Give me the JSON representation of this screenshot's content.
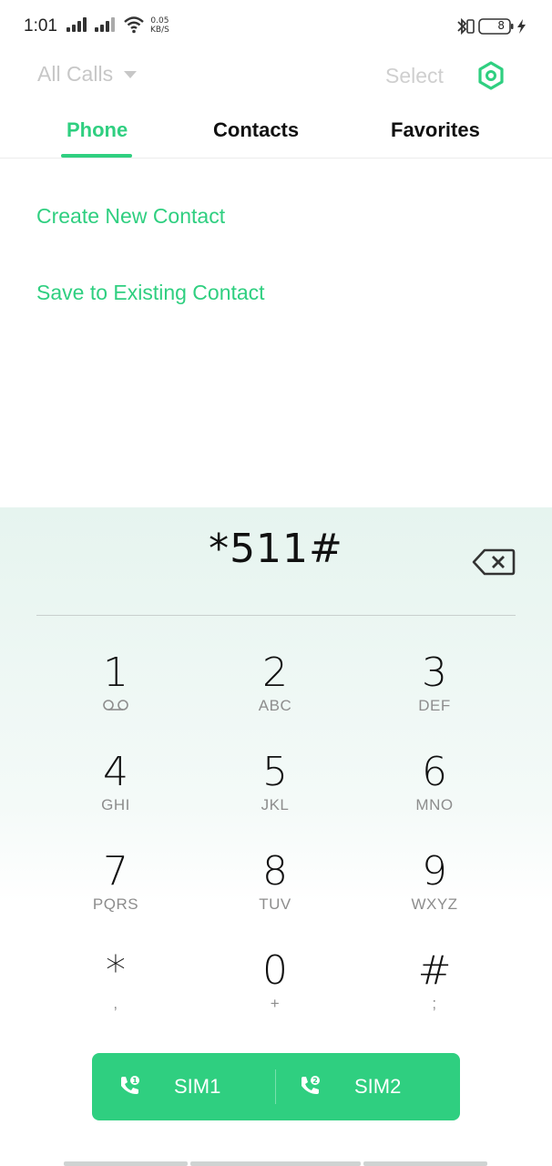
{
  "status_bar": {
    "time": "1:01",
    "net_speed_value": "0.05",
    "net_speed_unit": "KB/S",
    "battery": "8",
    "icons": [
      "signal-icon",
      "signal-icon",
      "wifi-icon",
      "bluetooth-icon",
      "vibrate-icon",
      "battery-icon",
      "charging-icon"
    ]
  },
  "header": {
    "filter_label": "All Calls",
    "select_label": "Select",
    "settings_icon": "settings-icon"
  },
  "tabs": [
    {
      "label": "Phone",
      "active": true
    },
    {
      "label": "Contacts",
      "active": false
    },
    {
      "label": "Favorites",
      "active": false
    }
  ],
  "actions": {
    "create_new": "Create New Contact",
    "save_existing": "Save to Existing Contact"
  },
  "dialer": {
    "number": "*511#",
    "backspace_icon": "backspace-icon",
    "keys": [
      {
        "digit": "1",
        "letters": ""
      },
      {
        "digit": "2",
        "letters": "ABC"
      },
      {
        "digit": "3",
        "letters": "DEF"
      },
      {
        "digit": "4",
        "letters": "GHI"
      },
      {
        "digit": "5",
        "letters": "JKL"
      },
      {
        "digit": "6",
        "letters": "MNO"
      },
      {
        "digit": "7",
        "letters": "PQRS"
      },
      {
        "digit": "8",
        "letters": "TUV"
      },
      {
        "digit": "9",
        "letters": "WXYZ"
      },
      {
        "digit": "*",
        "letters": ","
      },
      {
        "digit": "0",
        "letters": "+"
      },
      {
        "digit": "#",
        "letters": ";"
      }
    ],
    "sim1_label": "SIM1",
    "sim2_label": "SIM2"
  },
  "colors": {
    "accent": "#2fcf80",
    "muted": "#c7c7c7"
  }
}
